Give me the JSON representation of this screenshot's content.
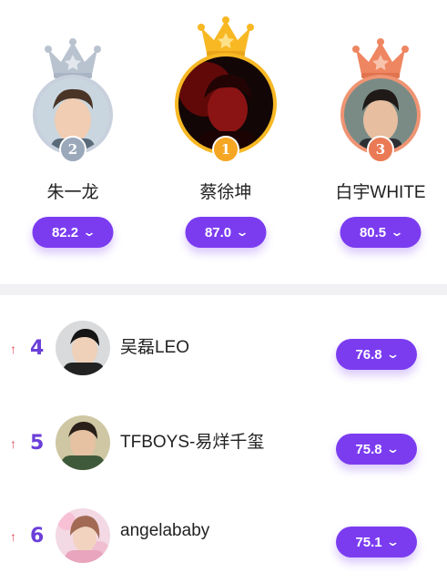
{
  "podium": [
    {
      "rank": "2",
      "name": "朱一龙",
      "score": "82.2",
      "crown_color": "#b9c3cf",
      "badge_color": "#9aa8ba",
      "ring_color": "#c7d0dc"
    },
    {
      "rank": "1",
      "name": "蔡徐坤",
      "score": "87.0",
      "crown_color": "#f7b824",
      "badge_color": "#f5a623",
      "ring_color": "#f7b824"
    },
    {
      "rank": "3",
      "name": "白宇WHITE",
      "score": "80.5",
      "crown_color": "#ee8661",
      "badge_color": "#ea7a55",
      "ring_color": "#ef9473"
    }
  ],
  "list": [
    {
      "trend": "↑",
      "rank": "4",
      "name": "吴磊LEO",
      "score": "76.8"
    },
    {
      "trend": "↑",
      "rank": "5",
      "name": "TFBOYS-易烊千玺",
      "score": "75.8"
    },
    {
      "trend": "↑",
      "rank": "6",
      "name": "angelababy",
      "score": "75.1"
    }
  ],
  "icons": {
    "crown": "crown-icon",
    "chevron": "chevron-down-icon",
    "trend_up": "arrow-up-icon"
  },
  "colors": {
    "accent": "#7b3cf0",
    "rank_text": "#6b3fd8",
    "trend_up": "#e24a5a"
  }
}
